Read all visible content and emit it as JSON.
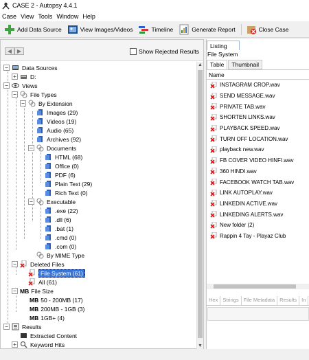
{
  "window": {
    "title": "CASE 2 - Autopsy 4.4.1"
  },
  "menu": [
    "Case",
    "View",
    "Tools",
    "Window",
    "Help"
  ],
  "toolbar": {
    "add_data_source": "Add Data Source",
    "view_images": "View Images/Videos",
    "timeline": "Timeline",
    "generate_report": "Generate Report",
    "close_case": "Close Case"
  },
  "left": {
    "show_rejected": "Show Rejected Results",
    "tree": {
      "data_sources": "Data Sources",
      "d_drive": "D:",
      "views": "Views",
      "file_types": "File Types",
      "by_extension": "By Extension",
      "images": "Images (29)",
      "videos": "Videos (19)",
      "audio": "Audio (65)",
      "archives": "Archives (92)",
      "documents": "Documents",
      "html": "HTML (68)",
      "office": "Office (0)",
      "pdf": "PDF (6)",
      "plain_text": "Plain Text (29)",
      "rich_text": "Rich Text (0)",
      "executable": "Executable",
      "exe": ".exe (22)",
      "dll": ".dll (6)",
      "bat": ".bat (1)",
      "cmd": ".cmd (0)",
      "com": ".com (0)",
      "by_mime": "By MIME Type",
      "deleted_files": "Deleted Files",
      "file_system": "File System (61)",
      "all": "All (61)",
      "mb_file_size": "File Size",
      "mb_label": "MB",
      "size_50_200": "50 - 200MB (17)",
      "size_200_1gb": "200MB - 1GB (3)",
      "size_1gb": "1GB+ (4)",
      "results": "Results",
      "extracted_content": "Extracted Content",
      "keyword_hits": "Keyword Hits"
    }
  },
  "right": {
    "listing_tab": "Listing",
    "path": "File System",
    "sub_tabs": [
      "Table",
      "Thumbnail"
    ],
    "column": "Name",
    "files": [
      "INSTAGRAM CROP.wav",
      "SEND MESSAGE.wav",
      "PRIVATE TAB.wav",
      "SHORTEN LINKS.wav",
      "PLAYBACK SPEED.wav",
      "TURN OFF LOCATION.wav",
      "playback new.wav",
      "FB COVER VIDEO HINFI.wav",
      "360 HINDI.wav",
      "FACEBOOK WATCH TAB.wav",
      "LINK AUTOPLAY.wav",
      "LINKEDIN ACTIVE.wav",
      "LINKEDING ALERTS.wav",
      "New folder (2)",
      "Rappin 4 Tay - Playaz Club"
    ],
    "bottom_tabs": [
      "Hex",
      "Strings",
      "File Metadata",
      "Results",
      "In"
    ]
  }
}
